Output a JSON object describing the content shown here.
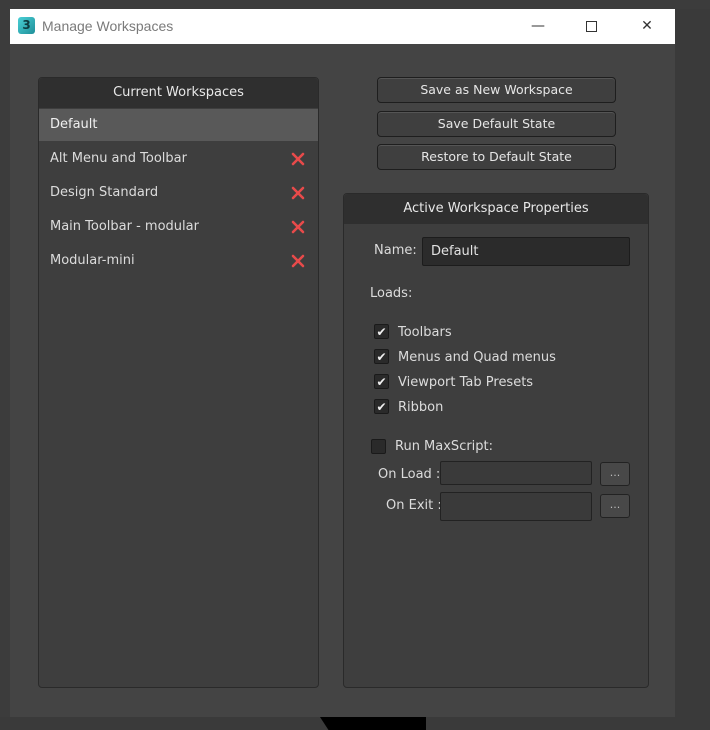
{
  "window": {
    "title": "Manage Workspaces",
    "app_icon": "3ds-max-icon",
    "app_icon_glyph": "3",
    "controls": {
      "minimize": "—",
      "close": "✕"
    }
  },
  "workspaces": {
    "header": "Current Workspaces",
    "items": [
      {
        "label": "Default",
        "selected": true,
        "deletable": false
      },
      {
        "label": "Alt Menu and Toolbar",
        "selected": false,
        "deletable": true
      },
      {
        "label": "Design Standard",
        "selected": false,
        "deletable": true
      },
      {
        "label": "Main Toolbar - modular",
        "selected": false,
        "deletable": true
      },
      {
        "label": "Modular-mini",
        "selected": false,
        "deletable": true
      }
    ]
  },
  "actions": {
    "save_new": "Save as New Workspace",
    "save_default": "Save Default State",
    "restore_default": "Restore to Default State"
  },
  "properties": {
    "header": "Active Workspace Properties",
    "name_label": "Name:",
    "name_value": "Default",
    "loads_label": "Loads:",
    "loads": [
      {
        "label": "Toolbars",
        "checked": true
      },
      {
        "label": "Menus and Quad menus",
        "checked": true
      },
      {
        "label": "Viewport Tab Presets",
        "checked": true
      },
      {
        "label": "Ribbon",
        "checked": true
      }
    ],
    "run_maxscript_label": "Run MaxScript:",
    "run_maxscript_checked": false,
    "on_load_label": "On Load :",
    "on_load_value": "",
    "on_exit_label": "On Exit :",
    "on_exit_value": "",
    "browse_label": "..."
  },
  "colors": {
    "delete_icon": "#e84a4a",
    "selected_row": "#595959"
  }
}
